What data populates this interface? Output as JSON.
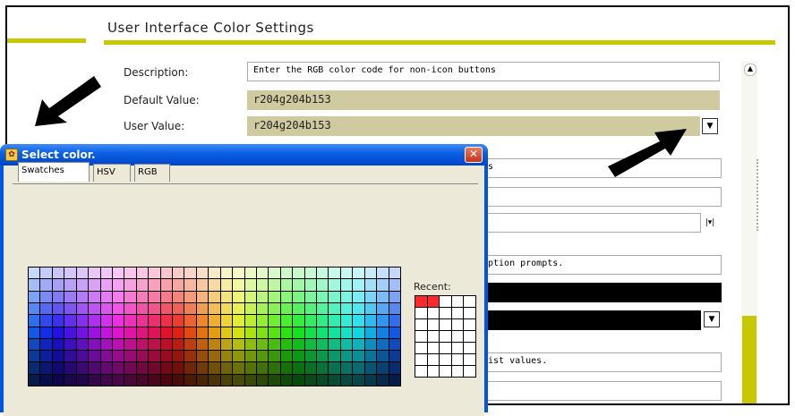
{
  "page": {
    "title": "User Interface Color Settings"
  },
  "form": {
    "description_label": "Description:",
    "description_value": "Enter the RGB color code for non-icon buttons",
    "default_label": "Default Value:",
    "default_value": "r204g204b153",
    "user_label": "User Value:",
    "user_value": "r204g204b153",
    "row_texts": [
      "s",
      "ption prompts.",
      "ist values."
    ]
  },
  "dialog": {
    "title": "Select color.",
    "close": "✕",
    "tabs": [
      "Swatches",
      "HSV",
      "RGB"
    ],
    "recent_label": "Recent:"
  },
  "colors": {
    "olive": "#c8c800",
    "tan": "#cfcaa0",
    "xp_blue": "#0054e3",
    "recent_red": "#ff2a2a"
  },
  "icons": {
    "dropdown": "chevron-down-icon",
    "arrows": "pointer-arrow-icon"
  }
}
